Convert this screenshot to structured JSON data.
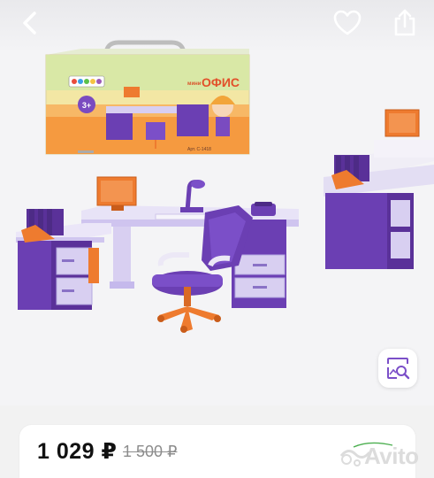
{
  "toolbar": {
    "back_icon": "chevron-left-icon",
    "favorite_icon": "heart-icon",
    "share_icon": "share-icon"
  },
  "gallery": {
    "box_brand_small": "мини",
    "box_brand": "ОФИС",
    "box_age": "3+",
    "box_article": "Арт. С-1418",
    "lens_icon": "image-search-icon"
  },
  "listing": {
    "price": "1 029 ₽",
    "old_price": "1 500 ₽"
  },
  "watermark": {
    "text": "Avito"
  },
  "colors": {
    "purple": "#6b3fb3",
    "lavender": "#d8cff1",
    "orange": "#ee7b2f",
    "price_text": "#111111",
    "old_price_text": "#8c8c8c"
  }
}
